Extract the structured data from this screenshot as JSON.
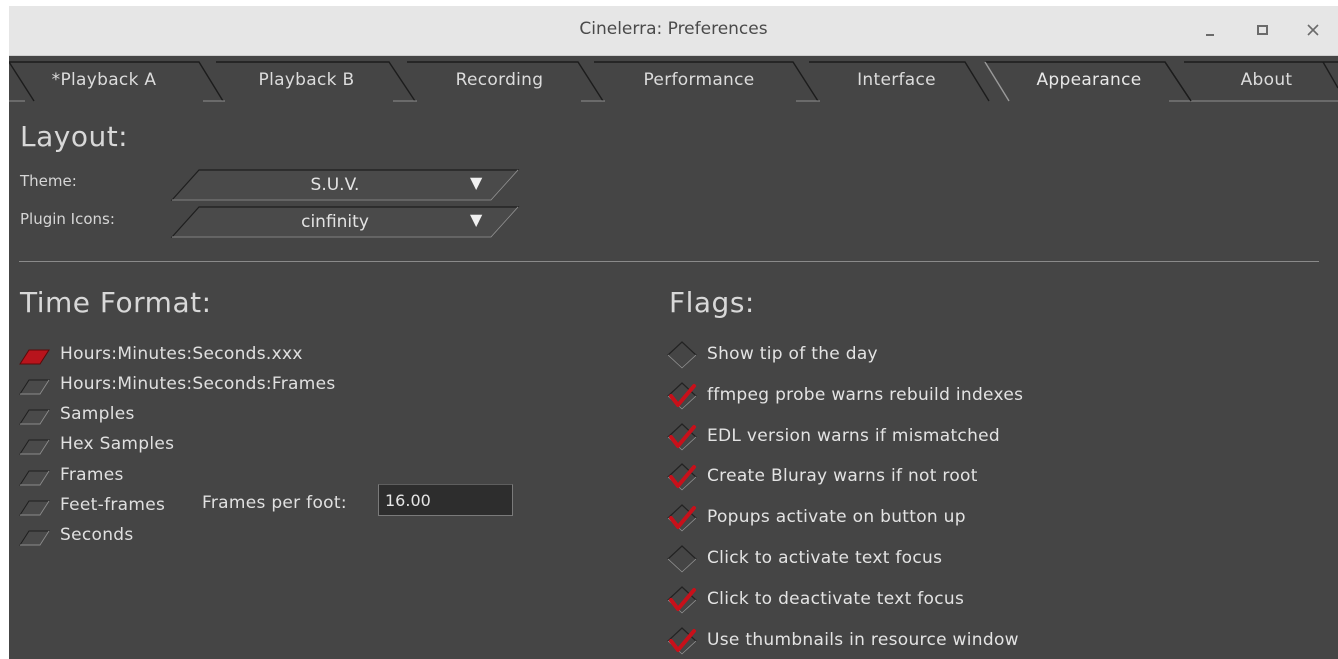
{
  "window": {
    "title": "Cinelerra: Preferences"
  },
  "tabs": [
    {
      "label": "*Playback A",
      "active": false
    },
    {
      "label": "Playback B",
      "active": false
    },
    {
      "label": "Recording",
      "active": false
    },
    {
      "label": "Performance",
      "active": false
    },
    {
      "label": "Interface",
      "active": false
    },
    {
      "label": "Appearance",
      "active": true
    },
    {
      "label": "About",
      "active": false
    }
  ],
  "layout": {
    "heading": "Layout:",
    "theme_label": "Theme:",
    "theme_value": "S.U.V.",
    "plugin_icons_label": "Plugin Icons:",
    "plugin_icons_value": "cinfinity"
  },
  "time_format": {
    "heading": "Time Format:",
    "options": [
      {
        "label": "Hours:Minutes:Seconds.xxx",
        "selected": true
      },
      {
        "label": "Hours:Minutes:Seconds:Frames",
        "selected": false
      },
      {
        "label": "Samples",
        "selected": false
      },
      {
        "label": "Hex Samples",
        "selected": false
      },
      {
        "label": "Frames",
        "selected": false
      },
      {
        "label": "Feet-frames",
        "selected": false
      },
      {
        "label": "Seconds",
        "selected": false
      }
    ],
    "frames_per_foot_label": "Frames per foot:",
    "frames_per_foot_value": "16.00"
  },
  "flags": {
    "heading": "Flags:",
    "items": [
      {
        "label": "Show tip of the day",
        "checked": false
      },
      {
        "label": "ffmpeg probe warns rebuild indexes",
        "checked": true
      },
      {
        "label": "EDL version warns if mismatched",
        "checked": true
      },
      {
        "label": "Create Bluray warns if not root",
        "checked": true
      },
      {
        "label": "Popups activate on button up",
        "checked": true
      },
      {
        "label": "Click to activate text focus",
        "checked": false
      },
      {
        "label": "Click to deactivate text focus",
        "checked": true
      },
      {
        "label": "Use thumbnails in resource window",
        "checked": true
      }
    ]
  },
  "colors": {
    "panel": "#454545",
    "accent": "#b8141c",
    "titlebar": "#e6e6e6"
  },
  "icons": [
    "minimize-icon",
    "maximize-icon",
    "close-icon",
    "dropdown-arrow-icon",
    "radio-icon",
    "check-icon"
  ]
}
